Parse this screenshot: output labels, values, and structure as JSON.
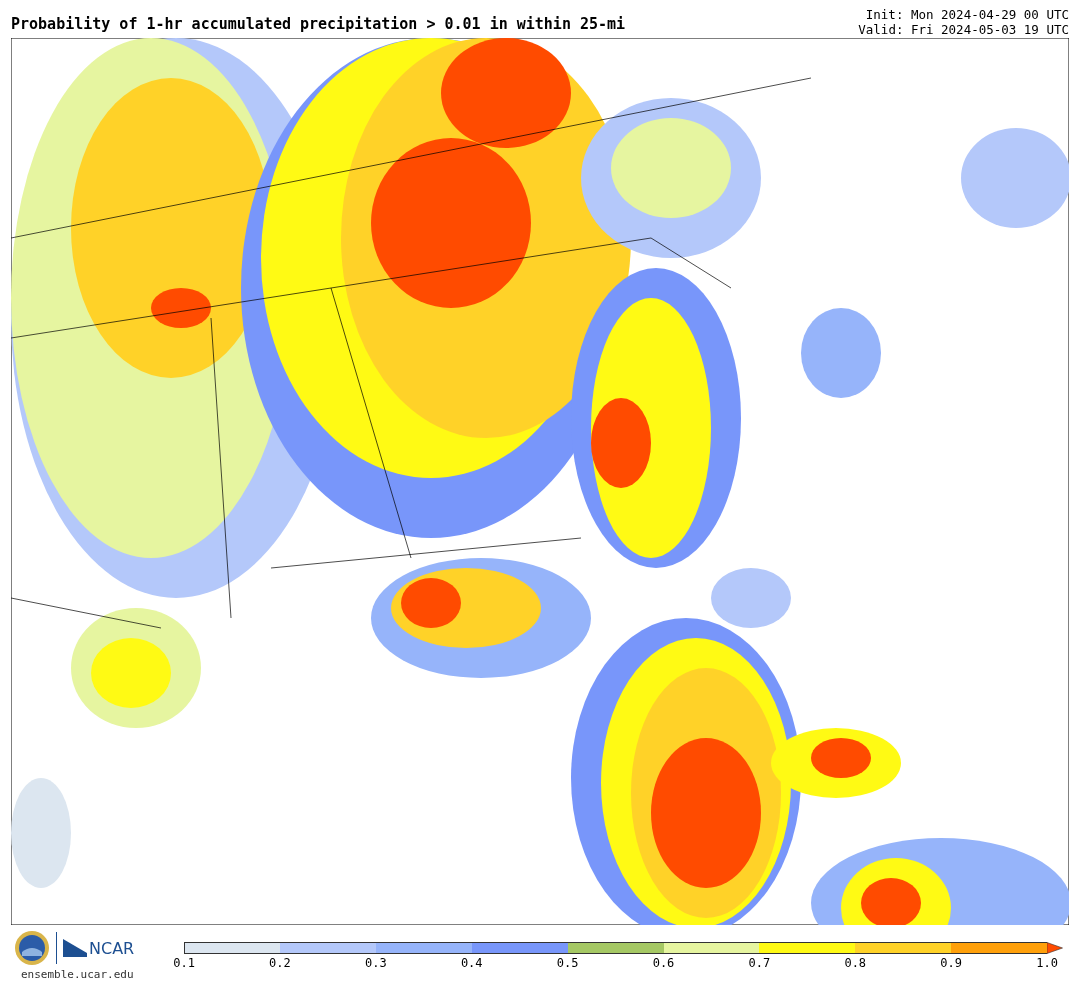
{
  "title": "Probability of 1-hr accumulated precipitation > 0.01 in within 25-mi",
  "init": "Init: Mon 2024-04-29 00 UTC",
  "valid": "Valid: Fri 2024-05-03 19 UTC",
  "logos": {
    "agency": "NCAR",
    "url": "ensemble.ucar.edu"
  },
  "legend": {
    "bins": [
      {
        "color": "#dce6f0"
      },
      {
        "color": "#b4c8fa"
      },
      {
        "color": "#96b4fa"
      },
      {
        "color": "#7896fa"
      },
      {
        "color": "#a5c864"
      },
      {
        "color": "#e6f5a0"
      },
      {
        "color": "#fffa14"
      },
      {
        "color": "#ffd228"
      },
      {
        "color": "#ffa00a"
      },
      {
        "color": "#ff4b00",
        "kind": "arrow"
      }
    ],
    "ticks": [
      "0.1",
      "0.2",
      "0.3",
      "0.4",
      "0.5",
      "0.6",
      "0.7",
      "0.8",
      "0.9",
      "1.0"
    ]
  }
}
